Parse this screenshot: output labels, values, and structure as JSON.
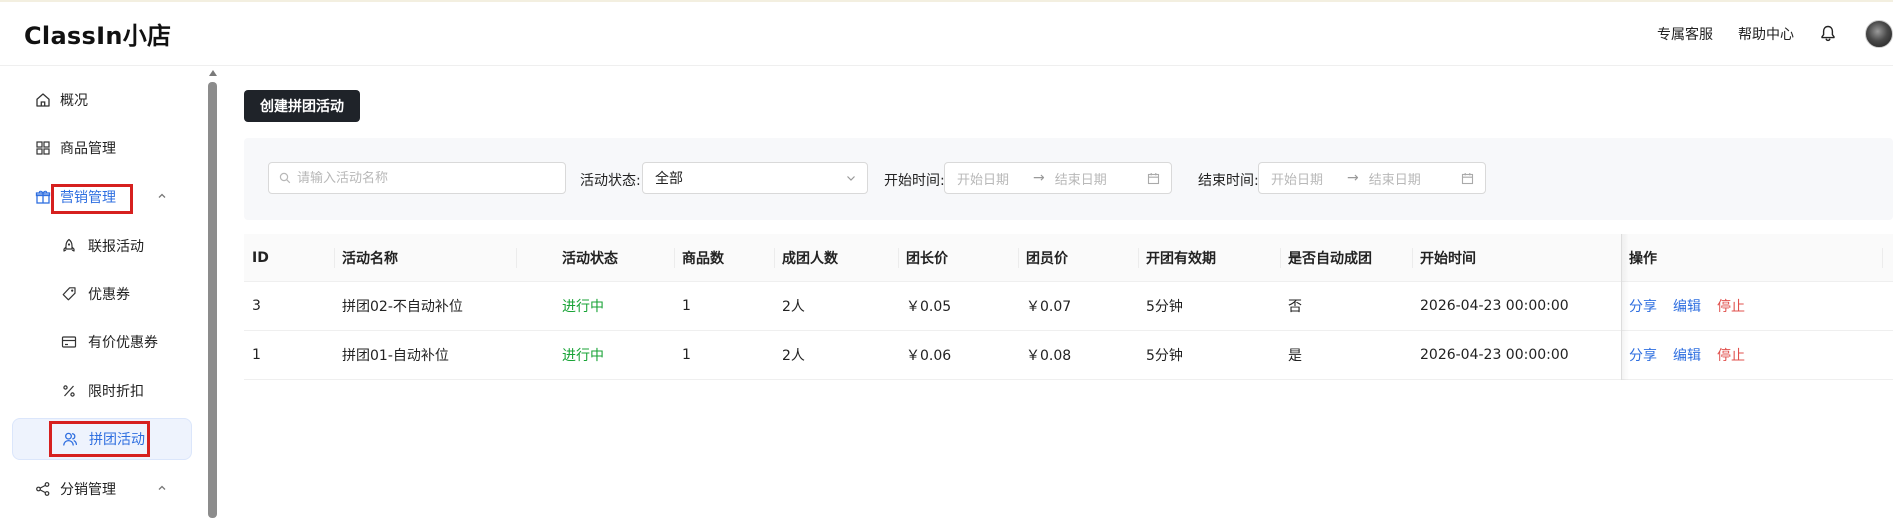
{
  "app": {
    "title": "ClassIn小店"
  },
  "header": {
    "links": [
      "专属客服",
      "帮助中心"
    ],
    "icons": [
      "bell-icon",
      "avatar"
    ]
  },
  "sidebar": {
    "items": [
      {
        "label": "概况",
        "icon": "home-icon"
      },
      {
        "label": "商品管理",
        "icon": "grid-icon"
      },
      {
        "label": "营销管理",
        "icon": "gift-icon",
        "expanded": true
      },
      {
        "label": "联报活动",
        "icon": "rocket-icon"
      },
      {
        "label": "优惠券",
        "icon": "tag-icon"
      },
      {
        "label": "有价优惠券",
        "icon": "card-icon"
      },
      {
        "label": "限时折扣",
        "icon": "percent-icon"
      },
      {
        "label": "拼团活动",
        "icon": "users-icon",
        "active": true
      },
      {
        "label": "分销管理",
        "icon": "share-icon",
        "expanded": true
      }
    ]
  },
  "main": {
    "create_button": "创建拼团活动",
    "filters": {
      "search_placeholder": "请输入活动名称",
      "status_label": "活动状态",
      "status_value": "全部",
      "start_label": "开始时间",
      "end_label": "结束时间",
      "range_start_placeholder": "开始日期",
      "range_end_placeholder": "结束日期",
      "range_arrow": "→"
    },
    "table": {
      "columns": [
        "ID",
        "活动名称",
        "活动状态",
        "商品数",
        "成团人数",
        "团长价",
        "团员价",
        "开团有效期",
        "是否自动成团",
        "开始时间",
        "操作"
      ],
      "rows": [
        {
          "id": "3",
          "name": "拼团02-不自动补位",
          "status": "进行中",
          "count": "1",
          "size": "2人",
          "leader": "￥0.05",
          "member": "￥0.07",
          "validity": "5分钟",
          "auto": "否",
          "start": "2026-04-23 00:00:00"
        },
        {
          "id": "1",
          "name": "拼团01-自动补位",
          "status": "进行中",
          "count": "1",
          "size": "2人",
          "leader": "￥0.06",
          "member": "￥0.08",
          "validity": "5分钟",
          "auto": "是",
          "start": "2026-04-23 00:00:00"
        }
      ],
      "actions": [
        "分享",
        "编辑",
        "停止"
      ]
    }
  },
  "colors": {
    "accent": "#2f6fe0",
    "status_active": "#18a336",
    "danger": "#e0504c",
    "highlight_box": "#d6201f"
  }
}
